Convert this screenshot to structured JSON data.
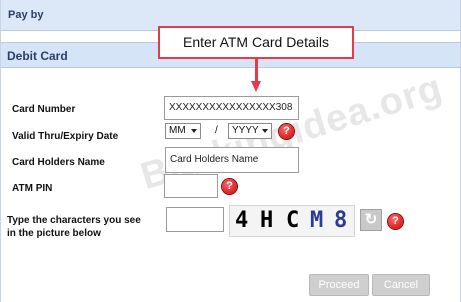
{
  "header": {
    "pay_by_label": "Pay by"
  },
  "section": {
    "title": "Debit Card"
  },
  "callout": {
    "text": "Enter ATM Card Details"
  },
  "form": {
    "card_number": {
      "label": "Card Number",
      "value": "XXXXXXXXXXXXXXXX308"
    },
    "expiry": {
      "label": "Valid Thru/Expiry Date",
      "month_value": "MM",
      "separator": "/",
      "year_value": "YYYY"
    },
    "holder_name": {
      "label": "Card Holders Name",
      "value": "Card Holders Name"
    },
    "atm_pin": {
      "label": "ATM PIN",
      "value": ""
    },
    "captcha": {
      "label_line1": "Type the characters you see",
      "label_line2": "in the picture below",
      "value": "",
      "characters": [
        "4",
        "H",
        "C",
        "M",
        "8"
      ],
      "char_colors": [
        "#000000",
        "#000000",
        "#000000",
        "#2a3d8f",
        "#2a3d8f"
      ]
    },
    "help_glyph": "?"
  },
  "watermark": {
    "text": "Bankingidea.org"
  },
  "buttons": {
    "proceed_label": "Proceed",
    "cancel_label": "Cancel"
  },
  "icons": {
    "help": "question-mark-icon",
    "refresh": "refresh-icon",
    "refresh_glyph": "↻"
  },
  "colors": {
    "accent_red": "#e53a47",
    "header_bg": "#dce8f8",
    "button_disabled": "#cfcfcf"
  }
}
